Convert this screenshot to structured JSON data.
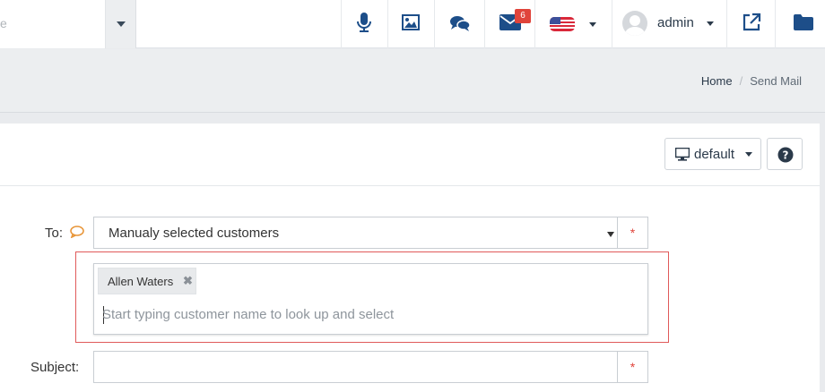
{
  "topbar": {
    "search_placeholder_fragment": "e",
    "mail_badge": "6",
    "user_name": "admin",
    "icons": [
      "microphone-icon",
      "image-icon",
      "chat-icon",
      "mail-icon",
      "us-flag-icon",
      "external-link-icon",
      "folder-icon"
    ]
  },
  "breadcrumb": {
    "home": "Home",
    "separator": "/",
    "current": "Send Mail"
  },
  "toolbar": {
    "layout_button": "default"
  },
  "form": {
    "to_label": "To:",
    "to_value": "Manualy selected customers",
    "required_mark": "*",
    "selected_customers": [
      "Allen Waters"
    ],
    "tag_remove": "✖",
    "customer_input_placeholder": "Start typing customer name to look up and select",
    "subject_label": "Subject:",
    "subject_value": ""
  },
  "colors": {
    "accent": "#1d4e89",
    "badge": "#e0443b",
    "highlight_border": "#e05a5a",
    "required": "#e0443b"
  }
}
